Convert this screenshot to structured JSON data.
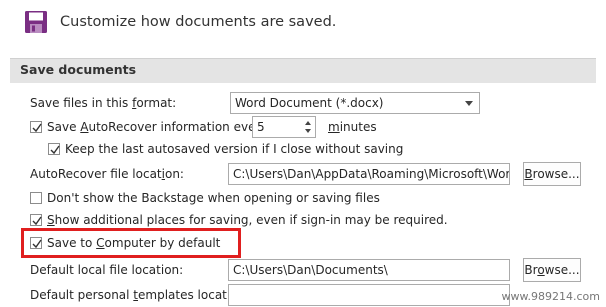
{
  "header": {
    "text": "Customize how documents are saved.",
    "icon": "save-disk-icon"
  },
  "section": {
    "title": "Save documents"
  },
  "format": {
    "label": "Save files in this format:",
    "value": "Word Document (*.docx)"
  },
  "autorecover": {
    "label": "Save AutoRecover information every",
    "value": "5",
    "unit": "minutes",
    "checked": true
  },
  "keep_last": {
    "label": "Keep the last autosaved version if I close without saving",
    "checked": true
  },
  "autorecover_location": {
    "label": "AutoRecover file location:",
    "value": "C:\\Users\\Dan\\AppData\\Roaming\\Microsoft\\Word\\",
    "button": "Browse..."
  },
  "backstage": {
    "label": "Don't show the Backstage when opening or saving files",
    "checked": false
  },
  "additional_places": {
    "label": "Show additional places for saving, even if sign-in may be required.",
    "checked": true
  },
  "save_computer": {
    "label": "Save to Computer by default",
    "checked": true
  },
  "default_local": {
    "label": "Default local file location:",
    "value": "C:\\Users\\Dan\\Documents\\",
    "button": "Browse..."
  },
  "default_templates": {
    "label": "Default personal templates location:",
    "value": ""
  },
  "watermark": "www.989214.com",
  "colors": {
    "highlight": "#e01f1f",
    "icon": "#7a2e83"
  }
}
